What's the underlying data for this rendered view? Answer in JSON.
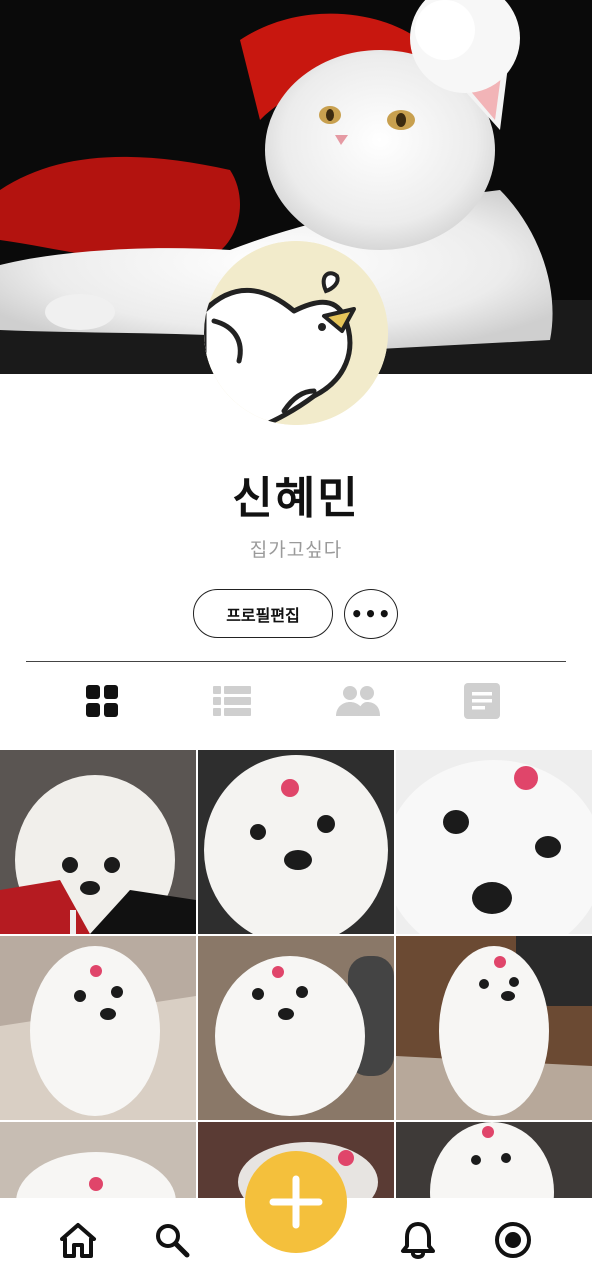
{
  "profile": {
    "name": "신혜민",
    "bio": "집가고싶다",
    "cover_subject": "white-cat-santa-hat",
    "avatar_subject": "cartoon-bird"
  },
  "actions": {
    "edit_label": "프로필편집",
    "more_label": "•••"
  },
  "tabs": [
    {
      "icon": "grid-icon",
      "active": true
    },
    {
      "icon": "list-icon",
      "active": false
    },
    {
      "icon": "people-icon",
      "active": false
    },
    {
      "icon": "document-icon",
      "active": false
    }
  ],
  "posts": [
    {
      "subject": "maltese-dog-red-jacket"
    },
    {
      "subject": "maltese-dog-pink-bow"
    },
    {
      "subject": "maltese-dog-closeup"
    },
    {
      "subject": "maltese-dog-on-blanket"
    },
    {
      "subject": "maltese-dog-lying"
    },
    {
      "subject": "maltese-dog-sitting-floor"
    },
    {
      "subject": "maltese-dog-partial"
    },
    {
      "subject": "maltese-dog-partial"
    },
    {
      "subject": "maltese-dog-partial"
    }
  ],
  "colors": {
    "accent": "#f4c03c",
    "text": "#111111",
    "muted": "#9a9a9a",
    "tab_inactive": "#cfcfcf"
  },
  "bottom_nav": [
    "home-icon",
    "search-icon",
    "add-icon",
    "bell-icon",
    "profile-icon"
  ]
}
